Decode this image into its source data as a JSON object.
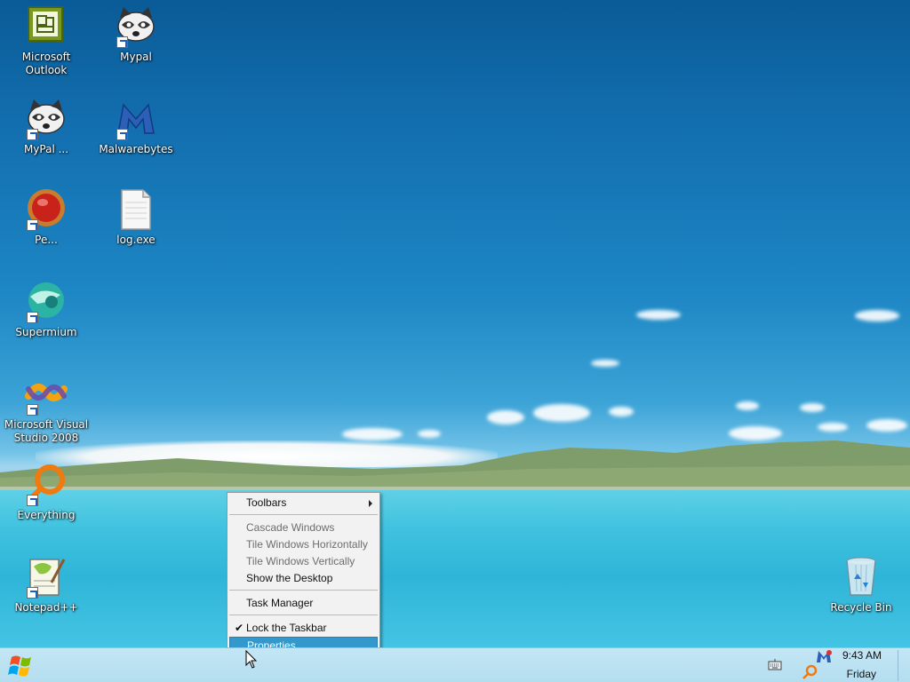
{
  "desktop": {
    "icons": [
      {
        "label": "Microsoft Outlook"
      },
      {
        "label": "Mypal"
      },
      {
        "label": "MyPal ..."
      },
      {
        "label": "Malwarebytes"
      },
      {
        "label": "Pe..."
      },
      {
        "label": "log.exe"
      },
      {
        "label": "Supermium"
      },
      {
        "label": "Microsoft Visual Studio 2008"
      },
      {
        "label": "Everything"
      },
      {
        "label": "Notepad++"
      },
      {
        "label": "Recycle Bin"
      }
    ]
  },
  "context_menu": {
    "items": [
      {
        "label": "Toolbars",
        "enabled": true,
        "submenu": true
      },
      {
        "label": "Cascade Windows",
        "enabled": false
      },
      {
        "label": "Tile Windows Horizontally",
        "enabled": false
      },
      {
        "label": "Tile Windows Vertically",
        "enabled": false
      },
      {
        "label": "Show the Desktop",
        "enabled": true
      },
      {
        "label": "Task Manager",
        "enabled": true
      },
      {
        "label": "Lock the Taskbar",
        "enabled": true,
        "checked": true
      },
      {
        "label": "Properties",
        "enabled": true,
        "selected": true
      }
    ]
  },
  "taskbar": {
    "clock_time": "9:43 AM",
    "clock_day": "Friday"
  },
  "colors": {
    "menu_highlight": "#3399cc",
    "taskbar": "#b4def0"
  }
}
